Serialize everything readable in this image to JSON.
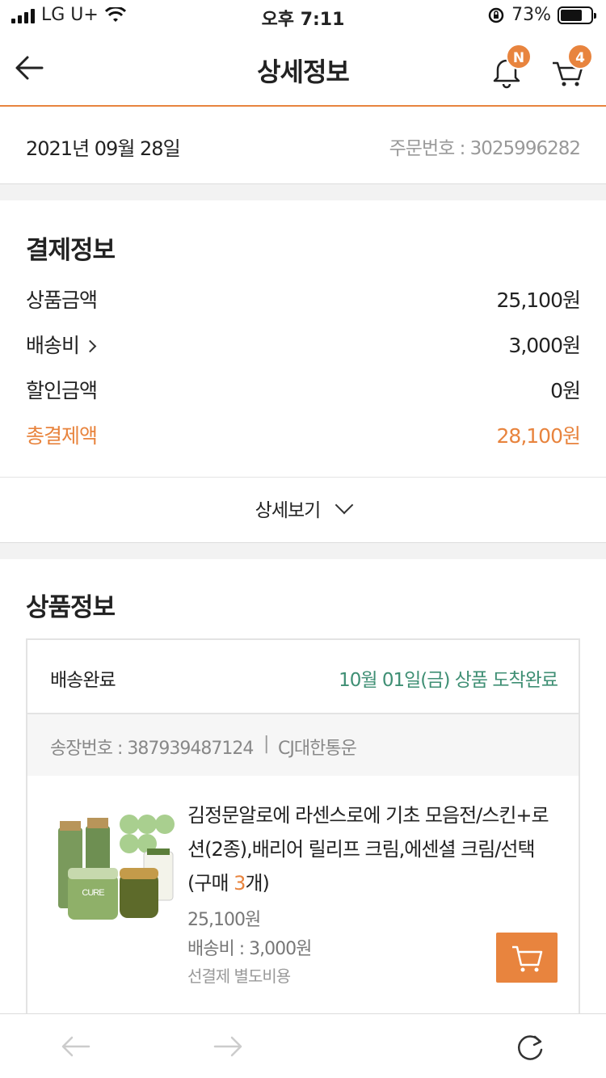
{
  "status_bar": {
    "carrier": "LG U+",
    "time": "오후 7:11",
    "battery": "73%",
    "battery_level": 0.73
  },
  "nav": {
    "title": "상세정보",
    "bell_badge": "N",
    "cart_badge": "4"
  },
  "order": {
    "date": "2021년 09월 28일",
    "order_number": "주문번호 : 3025996282"
  },
  "payment": {
    "title": "결제정보",
    "rows": [
      {
        "label": "상품금액",
        "value": "25,100원"
      },
      {
        "label": "배송비",
        "value": "3,000원"
      },
      {
        "label": "할인금액",
        "value": "0원"
      },
      {
        "label": "총결제액",
        "value": "28,100원"
      }
    ],
    "more_label": "상세보기"
  },
  "product": {
    "title": "상품정보",
    "delivery_status": "배송완료",
    "arrival": "10월 01일(금) 상품 도착완료",
    "invoice": "송장번호 : 387939487124",
    "courier": "CJ대한통운",
    "item": {
      "name_prefix": "김정문알로에 라센스로에 기초 모음전/스킨+로션(2종),배리어 릴리프 크림,에센셜 크림/선택 (구매 ",
      "qty": "3",
      "name_suffix": "개)",
      "price": "25,100원",
      "shipping": "배송비 : 3,000원",
      "prepaid": "선결제 별도비용",
      "thumb_text": "CURE"
    }
  },
  "colors": {
    "accent": "#e8843e",
    "arrival_green": "#3f8f74",
    "thumb_green": "#7a9a5c"
  }
}
